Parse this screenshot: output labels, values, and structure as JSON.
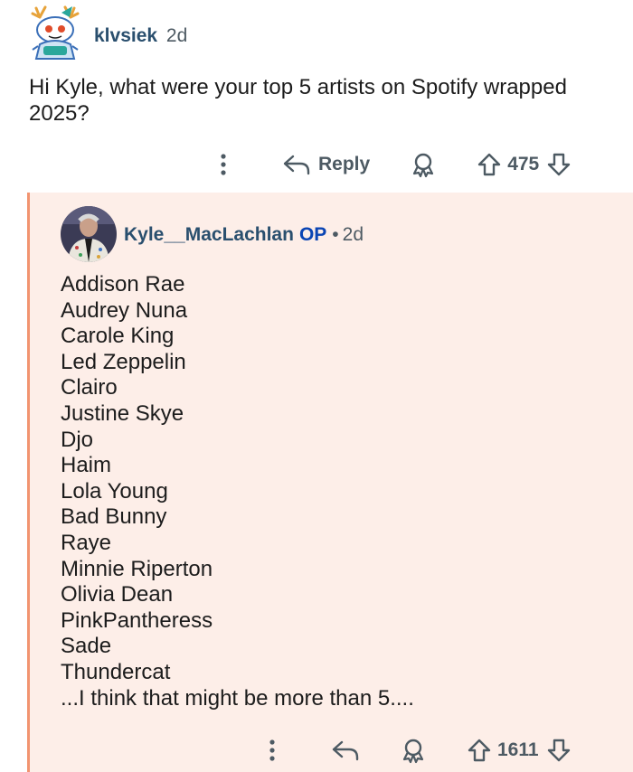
{
  "parent_comment": {
    "username": "klvsiek",
    "age": "2d",
    "body": "Hi Kyle, what were your top 5 artists on Spotify wrapped 2025?",
    "actions": {
      "more_icon": "vertical-dots-icon",
      "reply_icon": "reply-arrow-icon",
      "reply_label": "Reply",
      "award_icon": "award-icon",
      "upvote_icon": "upvote-arrow-icon",
      "score": "475",
      "downvote_icon": "downvote-arrow-icon"
    }
  },
  "reply_comment": {
    "username": "Kyle__MacLachlan",
    "op_badge": "OP",
    "separator": "•",
    "age": "2d",
    "artists": [
      "Addison Rae",
      "Audrey Nuna",
      "Carole King",
      "Led Zeppelin",
      "Clairo",
      "Justine Skye",
      "Djo",
      "Haim",
      "Lola Young",
      "Bad Bunny",
      "Raye",
      "Minnie Riperton",
      "Olivia Dean",
      "PinkPantheress",
      "Sade",
      "Thundercat",
      "...I think that might be more than 5...."
    ],
    "actions": {
      "more_icon": "vertical-dots-icon",
      "reply_icon": "reply-arrow-icon",
      "award_icon": "award-icon",
      "upvote_icon": "upvote-arrow-icon",
      "score": "1611",
      "downvote_icon": "downvote-arrow-icon"
    }
  },
  "colors": {
    "reply_background": "#fdeee8",
    "thread_line": "#f29470",
    "username": "#2a4f6e",
    "op_badge": "#0b45b4",
    "muted": "#4d5a63"
  }
}
